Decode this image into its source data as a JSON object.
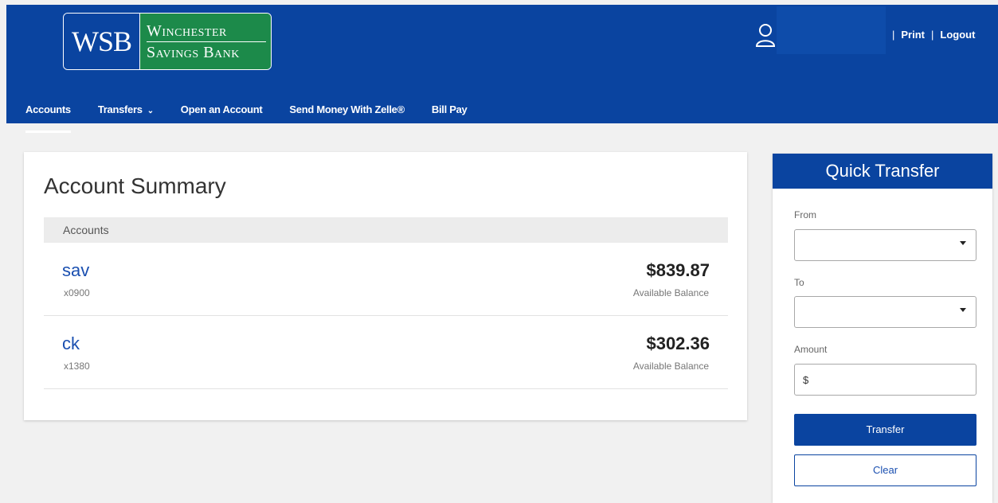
{
  "header": {
    "logo": {
      "abbr": "WSB",
      "line1": "Winchester",
      "line2": "Savings Bank"
    },
    "user_icon": "user-icon",
    "links": {
      "print": "Print",
      "logout": "Logout",
      "separator": "|"
    }
  },
  "nav": {
    "items": [
      {
        "label": "Accounts",
        "active": true
      },
      {
        "label": "Transfers",
        "has_dropdown": true
      },
      {
        "label": "Open an Account"
      },
      {
        "label": "Send Money With Zelle®"
      },
      {
        "label": "Bill Pay"
      }
    ]
  },
  "summary": {
    "title": "Account Summary",
    "table_header": "Accounts",
    "accounts": [
      {
        "name": "sav",
        "number": "x0900",
        "balance": "$839.87",
        "balance_label": "Available Balance"
      },
      {
        "name": "ck",
        "number": "x1380",
        "balance": "$302.36",
        "balance_label": "Available Balance"
      }
    ]
  },
  "quick_transfer": {
    "title": "Quick Transfer",
    "from_label": "From",
    "to_label": "To",
    "amount_label": "Amount",
    "amount_value": "$",
    "transfer_label": "Transfer",
    "clear_label": "Clear"
  },
  "colors": {
    "brand_blue": "#0a44a0",
    "brand_green": "#1c8a4a",
    "link_blue": "#1a4fb0"
  }
}
